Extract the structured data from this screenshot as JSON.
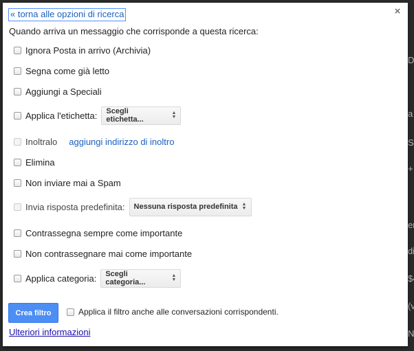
{
  "background_glyphs": [
    "Da",
    "a",
    "Sp",
    "+",
    "ere",
    "di",
    "$4",
    "(v",
    "N"
  ],
  "dialog": {
    "back_link": "« torna alle opzioni di ricerca",
    "close_symbol": "×",
    "intro": "Quando arriva un messaggio che corrisponde a questa ricerca:",
    "options": {
      "skip_inbox": "Ignora Posta in arrivo (Archivia)",
      "mark_read": "Segna come già letto",
      "star": "Aggiungi a Speciali",
      "apply_label": "Applica l'etichetta:",
      "apply_label_select": "Scegli etichetta...",
      "forward": "Inoltralo",
      "forward_link": "aggiungi indirizzo di inoltro",
      "delete": "Elimina",
      "never_spam": "Non inviare mai a Spam",
      "canned_response": "Invia risposta predefinita:",
      "canned_response_select": "Nessuna risposta predefinita",
      "always_important": "Contrassegna sempre come importante",
      "never_important": "Non contrassegnare mai come importante",
      "category": "Applica categoria:",
      "category_select": "Scegli categoria..."
    },
    "create_button": "Crea filtro",
    "apply_existing": "Applica il filtro anche alle conversazioni corrispondenti.",
    "more_info": "Ulteriori informazioni"
  }
}
